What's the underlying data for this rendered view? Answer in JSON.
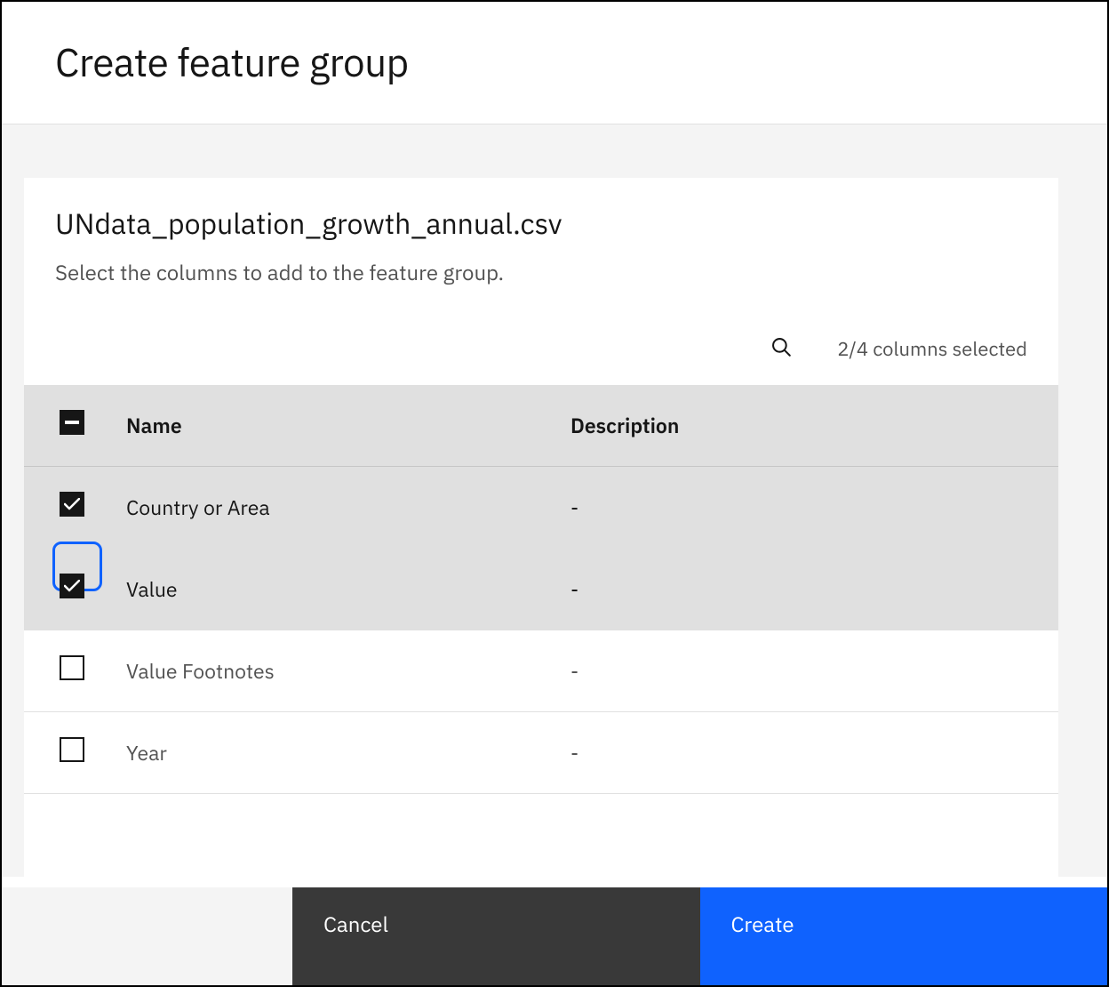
{
  "header": {
    "title": "Create feature group"
  },
  "card": {
    "file_name": "UNdata_population_growth_annual.csv",
    "subtitle": "Select the columns to add to the feature group.",
    "selection_status": "2/4 columns selected"
  },
  "table": {
    "headers": {
      "name": "Name",
      "description": "Description"
    },
    "rows": [
      {
        "name": "Country or Area",
        "description": "-",
        "checked": true,
        "focused": false
      },
      {
        "name": "Value",
        "description": "-",
        "checked": true,
        "focused": true
      },
      {
        "name": "Value Footnotes",
        "description": "-",
        "checked": false,
        "focused": false
      },
      {
        "name": "Year",
        "description": "-",
        "checked": false,
        "focused": false
      }
    ]
  },
  "footer": {
    "cancel_label": "Cancel",
    "create_label": "Create"
  }
}
